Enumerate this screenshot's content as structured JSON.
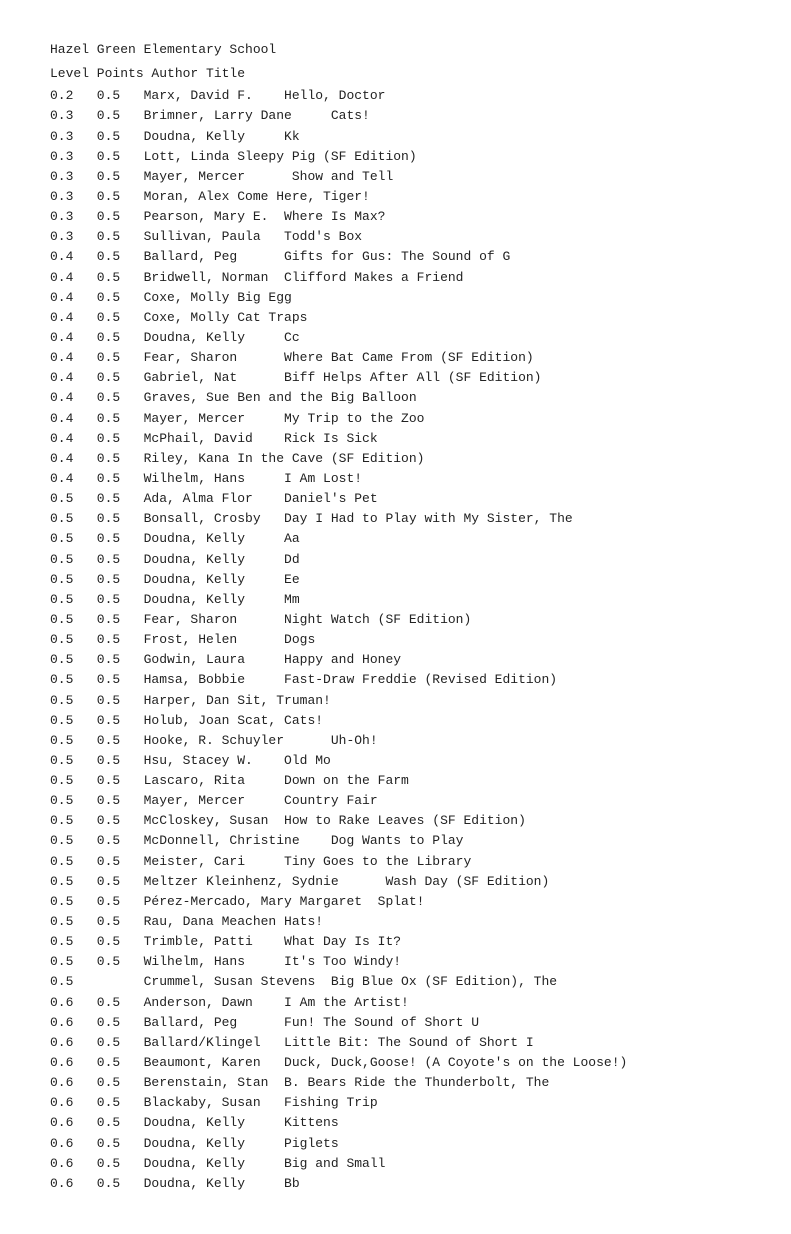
{
  "header": {
    "school": "Hazel Green Elementary School",
    "columns": "Level Points      Author       Title"
  },
  "rows": [
    "0.2   0.5   Marx, David F.    Hello, Doctor",
    "0.3   0.5   Brimner, Larry Dane     Cats!",
    "0.3   0.5   Doudna, Kelly     Kk",
    "0.3   0.5   Lott, Linda Sleepy Pig (SF Edition)",
    "0.3   0.5   Mayer, Mercer      Show and Tell",
    "0.3   0.5   Moran, Alex Come Here, Tiger!",
    "0.3   0.5   Pearson, Mary E.  Where Is Max?",
    "0.3   0.5   Sullivan, Paula   Todd's Box",
    "0.4   0.5   Ballard, Peg      Gifts for Gus: The Sound of G",
    "0.4   0.5   Bridwell, Norman  Clifford Makes a Friend",
    "0.4   0.5   Coxe, Molly Big Egg",
    "0.4   0.5   Coxe, Molly Cat Traps",
    "0.4   0.5   Doudna, Kelly     Cc",
    "0.4   0.5   Fear, Sharon      Where Bat Came From (SF Edition)",
    "0.4   0.5   Gabriel, Nat      Biff Helps After All (SF Edition)",
    "0.4   0.5   Graves, Sue Ben and the Big Balloon",
    "0.4   0.5   Mayer, Mercer     My Trip to the Zoo",
    "0.4   0.5   McPhail, David    Rick Is Sick",
    "0.4   0.5   Riley, Kana In the Cave (SF Edition)",
    "0.4   0.5   Wilhelm, Hans     I Am Lost!",
    "0.5   0.5   Ada, Alma Flor    Daniel's Pet",
    "0.5   0.5   Bonsall, Crosby   Day I Had to Play with My Sister, The",
    "0.5   0.5   Doudna, Kelly     Aa",
    "0.5   0.5   Doudna, Kelly     Dd",
    "0.5   0.5   Doudna, Kelly     Ee",
    "0.5   0.5   Doudna, Kelly     Mm",
    "0.5   0.5   Fear, Sharon      Night Watch (SF Edition)",
    "0.5   0.5   Frost, Helen      Dogs",
    "0.5   0.5   Godwin, Laura     Happy and Honey",
    "0.5   0.5   Hamsa, Bobbie     Fast-Draw Freddie (Revised Edition)",
    "0.5   0.5   Harper, Dan Sit, Truman!",
    "0.5   0.5   Holub, Joan Scat, Cats!",
    "0.5   0.5   Hooke, R. Schuyler      Uh-Oh!",
    "0.5   0.5   Hsu, Stacey W.    Old Mo",
    "0.5   0.5   Lascaro, Rita     Down on the Farm",
    "0.5   0.5   Mayer, Mercer     Country Fair",
    "0.5   0.5   McCloskey, Susan  How to Rake Leaves (SF Edition)",
    "0.5   0.5   McDonnell, Christine    Dog Wants to Play",
    "0.5   0.5   Meister, Cari     Tiny Goes to the Library",
    "0.5   0.5   Meltzer Kleinhenz, Sydnie      Wash Day (SF Edition)",
    "0.5   0.5   Pérez-Mercado, Mary Margaret  Splat!",
    "0.5   0.5   Rau, Dana Meachen Hats!",
    "0.5   0.5   Trimble, Patti    What Day Is It?",
    "0.5   0.5   Wilhelm, Hans     It's Too Windy!",
    "0.5         Crummel, Susan Stevens  Big Blue Ox (SF Edition), The",
    "0.6   0.5   Anderson, Dawn    I Am the Artist!",
    "0.6   0.5   Ballard, Peg      Fun! The Sound of Short U",
    "0.6   0.5   Ballard/Klingel   Little Bit: The Sound of Short I",
    "0.6   0.5   Beaumont, Karen   Duck, Duck,Goose! (A Coyote's on the Loose!)",
    "0.6   0.5   Berenstain, Stan  B. Bears Ride the Thunderbolt, The",
    "0.6   0.5   Blackaby, Susan   Fishing Trip",
    "0.6   0.5   Doudna, Kelly     Kittens",
    "0.6   0.5   Doudna, Kelly     Piglets",
    "0.6   0.5   Doudna, Kelly     Big and Small",
    "0.6   0.5   Doudna, Kelly     Bb"
  ]
}
